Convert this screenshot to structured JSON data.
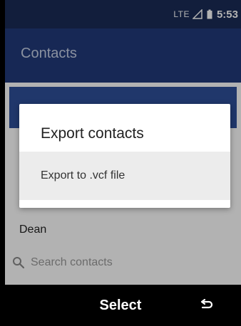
{
  "status_bar": {
    "network": "LTE",
    "time": "5:53"
  },
  "app_bar": {
    "title": "Contacts"
  },
  "contacts": {
    "visible_name": "Dean"
  },
  "search": {
    "placeholder": "Search contacts"
  },
  "dialog": {
    "title": "Export contacts",
    "options": [
      "Export to .vcf file"
    ]
  },
  "softkeys": {
    "center_label": "Select",
    "right_icon": "back-icon"
  },
  "colors": {
    "status_bar": "#1b2c57",
    "app_bar": "#223a7a",
    "accent_row": "#2f4f9a"
  }
}
